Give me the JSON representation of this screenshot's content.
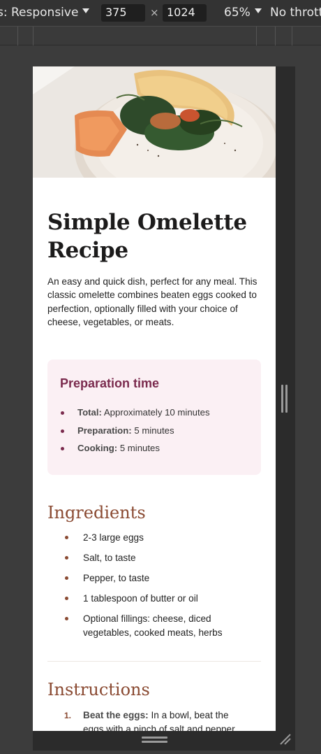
{
  "devtools": {
    "device_label": "s: Responsive",
    "width_value": "375",
    "dimension_separator": "×",
    "height_value": "1024",
    "zoom": "65%",
    "throttling": "No thrott"
  },
  "recipe": {
    "title": "Simple Omelette Recipe",
    "intro": "An easy and quick dish, perfect for any meal. This classic omelette combines beaten eggs cooked to perfection, optionally filled with your choice of cheese, vegetables, or meats.",
    "preparation": {
      "heading": "Preparation time",
      "items": [
        {
          "label": "Total:",
          "value": "Approximately 10 minutes"
        },
        {
          "label": "Preparation:",
          "value": "5 minutes"
        },
        {
          "label": "Cooking:",
          "value": "5 minutes"
        }
      ]
    },
    "ingredients": {
      "heading": "Ingredients",
      "items": [
        "2-3 large eggs",
        "Salt, to taste",
        "Pepper, to taste",
        "1 tablespoon of butter or oil",
        "Optional fillings: cheese, diced vegetables, cooked meats, herbs"
      ]
    },
    "instructions": {
      "heading": "Instructions",
      "items": [
        {
          "number": "1.",
          "label": "Beat the eggs:",
          "value": "In a bowl, beat the eggs with a pinch of salt and pepper"
        }
      ]
    }
  },
  "colors": {
    "accent_plum": "#7a2a4d",
    "accent_brown": "#8a4a32",
    "prep_background": "#fbf0f4"
  }
}
